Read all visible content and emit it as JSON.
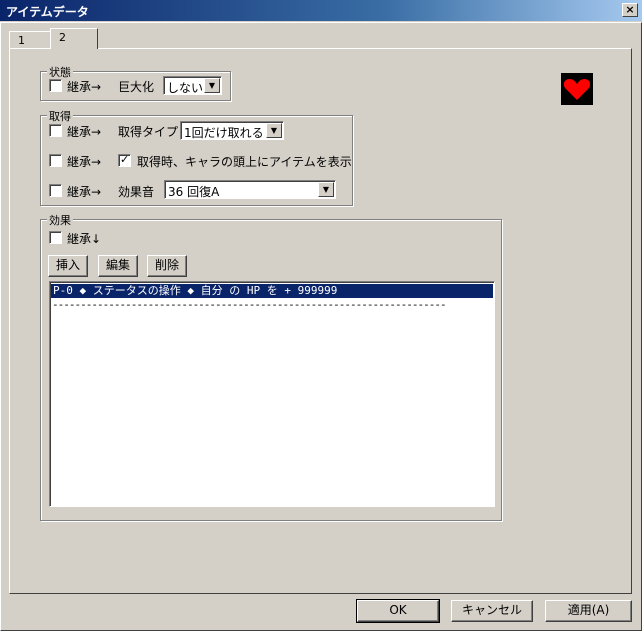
{
  "window": {
    "title": "アイテムデータ",
    "close_glyph": "×"
  },
  "tabs": [
    {
      "label": "1"
    },
    {
      "label": "2"
    }
  ],
  "state_group": {
    "title": "状態",
    "inherit_label": "継承→",
    "giant_label": "巨大化",
    "giant_value": "しない"
  },
  "acquire_group": {
    "title": "取得",
    "row1": {
      "inherit_label": "継承→",
      "type_label": "取得タイプ",
      "type_value": "1回だけ取れる"
    },
    "row2": {
      "inherit_label": "継承→",
      "show_label": "取得時、キャラの頭上にアイテムを表示"
    },
    "row3": {
      "inherit_label": "継承→",
      "se_label": "効果音",
      "se_value": "36 回復A"
    }
  },
  "effect_group": {
    "title": "効果",
    "inherit_label": "継承↓",
    "insert": "挿入",
    "edit": "編集",
    "delete": "削除",
    "rows": [
      "P-0 ◆ ステータスの操作 ◆ 自分 の HP を + 999999",
      "----------------------------------------------------------------------"
    ]
  },
  "footer": {
    "ok": "OK",
    "cancel": "キャンセル",
    "apply": "適用(A)"
  },
  "icon": {
    "name": "heart-icon",
    "color": "#ff0000"
  }
}
